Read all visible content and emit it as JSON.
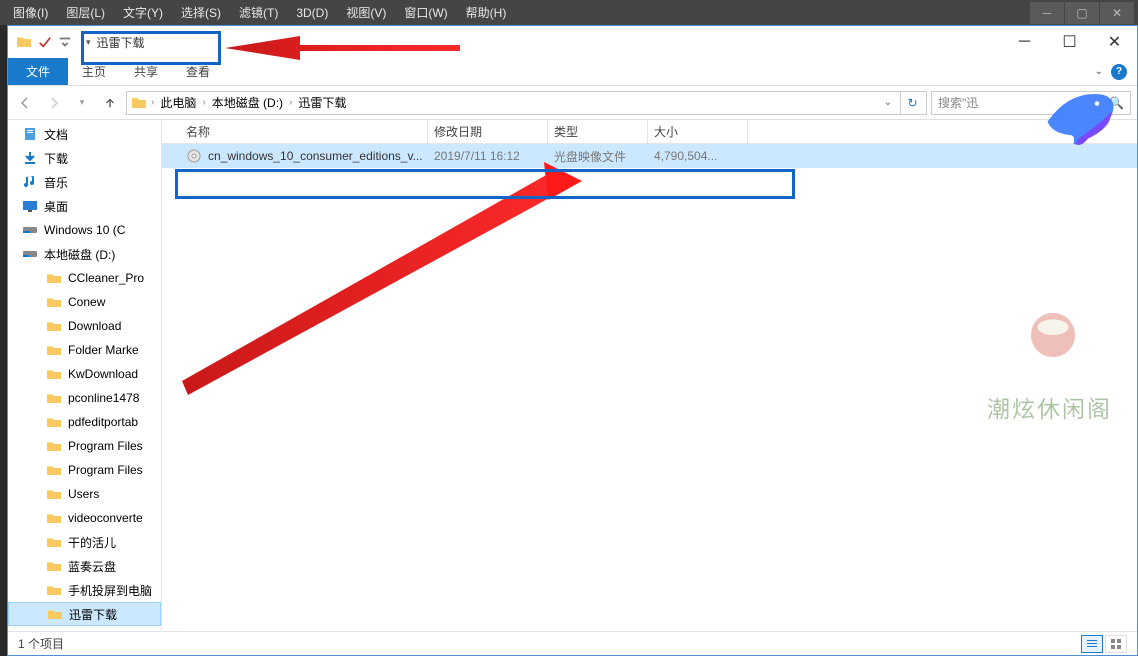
{
  "ps_menu": [
    "图像(I)",
    "图层(L)",
    "文字(Y)",
    "选择(S)",
    "滤镜(T)",
    "3D(D)",
    "视图(V)",
    "窗口(W)",
    "帮助(H)"
  ],
  "explorer": {
    "title": "迅雷下载",
    "ribbon": {
      "file": "文件",
      "tabs": [
        "主页",
        "共享",
        "查看"
      ]
    },
    "breadcrumbs": [
      "此电脑",
      "本地磁盘 (D:)",
      "迅雷下载"
    ],
    "search_placeholder": "搜索\"迅",
    "columns": {
      "name": "名称",
      "date": "修改日期",
      "type": "类型",
      "size": "大小"
    },
    "file": {
      "name": "cn_windows_10_consumer_editions_v...",
      "date": "2019/7/11 16:12",
      "type": "光盘映像文件",
      "size": "4,790,504..."
    },
    "tree": {
      "documents": "文档",
      "downloads": "下载",
      "music": "音乐",
      "desktop": "桌面",
      "win10": "Windows 10 (C",
      "ddrive": "本地磁盘 (D:)",
      "folders": [
        "CCleaner_Pro",
        "Conew",
        "Download",
        "Folder Marke",
        "KwDownload",
        "pconline1478",
        "pdfeditportab",
        "Program Files",
        "Program Files",
        "Users",
        "videoconverte",
        "干的活儿",
        "蓝奏云盘",
        "手机投屏到电脑",
        "迅雷下载"
      ]
    },
    "status": "1 个项目"
  },
  "watermark_text": "潮炫休闲阁"
}
